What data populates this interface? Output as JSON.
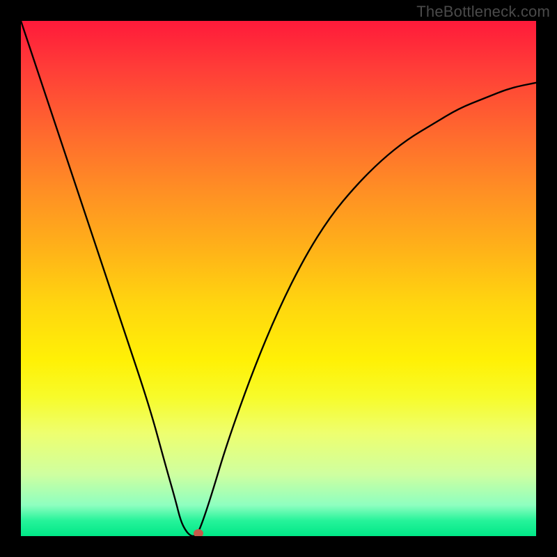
{
  "watermark_text": "TheBottleneck.com",
  "colors": {
    "frame_bg": "#000000",
    "curve_stroke": "#000000",
    "marker_fill": "#c65a4a",
    "watermark": "#4a4a4a"
  },
  "chart_data": {
    "type": "line",
    "title": "",
    "xlabel": "",
    "ylabel": "",
    "xlim": [
      0,
      100
    ],
    "ylim": [
      0,
      100
    ],
    "grid": false,
    "legend": false,
    "series": [
      {
        "name": "bottleneck-curve",
        "x": [
          0,
          5,
          10,
          15,
          20,
          25,
          28,
          30,
          31,
          32,
          33,
          34,
          35,
          37,
          40,
          45,
          50,
          55,
          60,
          65,
          70,
          75,
          80,
          85,
          90,
          95,
          100
        ],
        "values": [
          100,
          85,
          70,
          55,
          40,
          25,
          14,
          7,
          3,
          1,
          0,
          0,
          2,
          8,
          18,
          32,
          44,
          54,
          62,
          68,
          73,
          77,
          80,
          83,
          85,
          87,
          88
        ]
      }
    ],
    "flat_bottom": {
      "x_start": 31.5,
      "x_end": 34.5,
      "y": 0
    },
    "marker": {
      "x": 34.5,
      "y": 0.5,
      "name": "optimal-point"
    },
    "background_gradient_stops": [
      {
        "pct": 0,
        "color": "#ff1a3a"
      },
      {
        "pct": 9,
        "color": "#ff3c38"
      },
      {
        "pct": 22,
        "color": "#ff6a2e"
      },
      {
        "pct": 33,
        "color": "#ff8f24"
      },
      {
        "pct": 44,
        "color": "#ffb119"
      },
      {
        "pct": 55,
        "color": "#ffd60f"
      },
      {
        "pct": 66,
        "color": "#fff106"
      },
      {
        "pct": 73,
        "color": "#f7fb2a"
      },
      {
        "pct": 80,
        "color": "#eeff6f"
      },
      {
        "pct": 88,
        "color": "#cfffa0"
      },
      {
        "pct": 94,
        "color": "#8effc0"
      },
      {
        "pct": 97,
        "color": "#26f39a"
      },
      {
        "pct": 100,
        "color": "#00e887"
      }
    ]
  }
}
